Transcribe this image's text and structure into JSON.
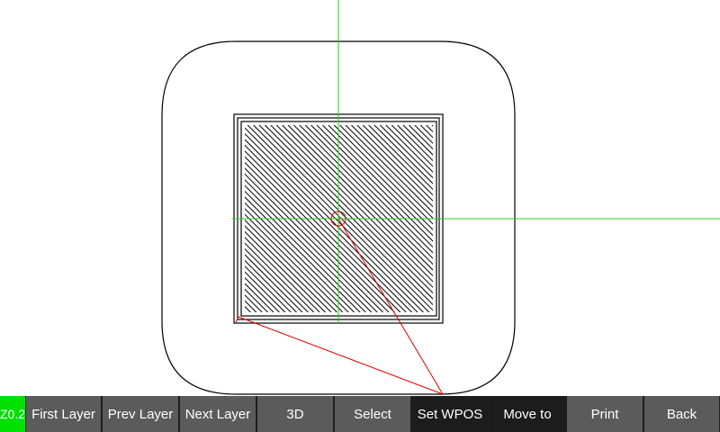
{
  "layer_indicator": {
    "label": "Z0.2",
    "color": "#00e000"
  },
  "toolbar": {
    "buttons": [
      {
        "label": "First Layer",
        "style": "normal"
      },
      {
        "label": "Prev Layer",
        "style": "normal"
      },
      {
        "label": "Next Layer",
        "style": "normal"
      },
      {
        "label": "3D",
        "style": "normal"
      },
      {
        "label": "Select",
        "style": "normal"
      },
      {
        "label": "Set WPOS",
        "style": "dark"
      },
      {
        "label": "Move to",
        "style": "dark"
      },
      {
        "label": "Print",
        "style": "normal"
      },
      {
        "label": "Back",
        "style": "normal"
      }
    ]
  },
  "colors": {
    "crosshair": "#22cc22",
    "travel_path": "#dd0000",
    "toolpath": "#000000",
    "background": "#ffffff"
  }
}
